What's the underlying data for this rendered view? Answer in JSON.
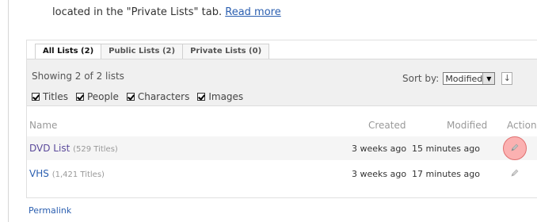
{
  "intro": {
    "text": "located in the \"Private Lists\" tab.",
    "read_more": "Read more"
  },
  "tabs": [
    {
      "label": "All Lists (2)",
      "active": true
    },
    {
      "label": "Public Lists (2)",
      "active": false
    },
    {
      "label": "Private Lists (0)",
      "active": false
    }
  ],
  "panel": {
    "showing": "Showing 2 of 2 lists",
    "sort_label": "Sort by:",
    "sort_value": "Modified",
    "sort_direction_icon": "sort-direction-icon",
    "filters": [
      {
        "label": "Titles",
        "checked": true
      },
      {
        "label": "People",
        "checked": true
      },
      {
        "label": "Characters",
        "checked": true
      },
      {
        "label": "Images",
        "checked": true
      }
    ]
  },
  "table": {
    "headers": {
      "name": "Name",
      "created": "Created",
      "modified": "Modified",
      "actions": "Actions"
    },
    "rows": [
      {
        "name": "DVD List",
        "count": "(529 Titles)",
        "created": "3 weeks ago",
        "modified": "15 minutes ago",
        "action_icon": "pencil-icon"
      },
      {
        "name": "VHS",
        "count": "(1,421 Titles)",
        "created": "3 weeks ago",
        "modified": "17 minutes ago",
        "action_icon": "pencil-icon"
      }
    ]
  },
  "footer": {
    "permalink": "Permalink"
  },
  "colors": {
    "link": "#2b5fb0",
    "list_name_visited": "#5b4a9b",
    "highlight": "#f07878"
  }
}
